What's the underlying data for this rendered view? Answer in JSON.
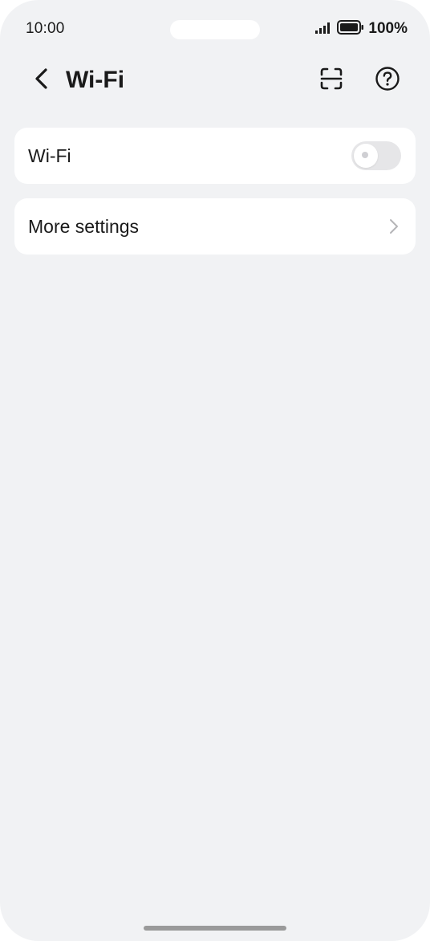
{
  "status_bar": {
    "time": "10:00",
    "battery_percent": "100%",
    "icons": [
      "signal-icon",
      "battery-icon"
    ]
  },
  "header": {
    "back_icon": "chevron-left-icon",
    "title": "Wi-Fi",
    "scan_icon": "scan-icon",
    "help_icon": "help-icon"
  },
  "settings": {
    "wifi": {
      "label": "Wi-Fi",
      "enabled": false
    },
    "more_settings": {
      "label": "More settings",
      "icon": "chevron-right-icon"
    }
  },
  "colors": {
    "background": "#f1f2f4",
    "card": "#ffffff",
    "text": "#1a1a1a",
    "toggle_off": "#e6e6e8"
  }
}
